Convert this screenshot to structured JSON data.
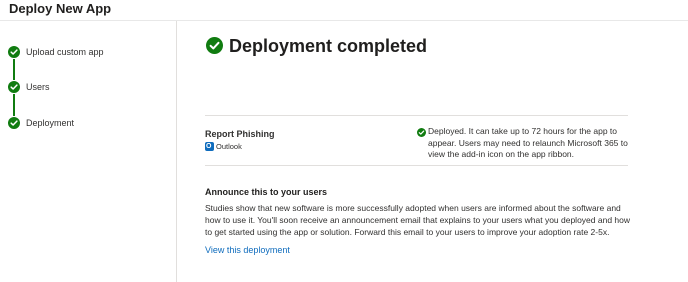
{
  "app": {
    "title": "Deploy New App"
  },
  "sidebar": {
    "steps": [
      {
        "label": "Upload custom app",
        "status": "complete"
      },
      {
        "label": "Users",
        "status": "complete"
      },
      {
        "label": "Deployment",
        "status": "complete"
      }
    ]
  },
  "main": {
    "title": "Deployment completed",
    "deployment": {
      "app_name": "Report Phishing",
      "host_app": "Outlook",
      "host_icon": "outlook-icon",
      "status_text": "Deployed. It can take up to 72 hours for the app to appear. Users may need to relaunch Microsoft 365 to view the add-in icon on the app ribbon."
    },
    "announce": {
      "title": "Announce this to your users",
      "body": "Studies show that new software is more successfully adopted when users are informed about the software and how to use it. You'll soon receive an announcement email that explains to your users what you deployed and how to get started using the app or solution. Forward this email to your users to improve your adoption rate 2-5x."
    },
    "link": "View this deployment"
  },
  "colors": {
    "success": "#107c10",
    "link": "#0f6cbd",
    "text": "#323130",
    "divider": "#e1dfdd"
  }
}
